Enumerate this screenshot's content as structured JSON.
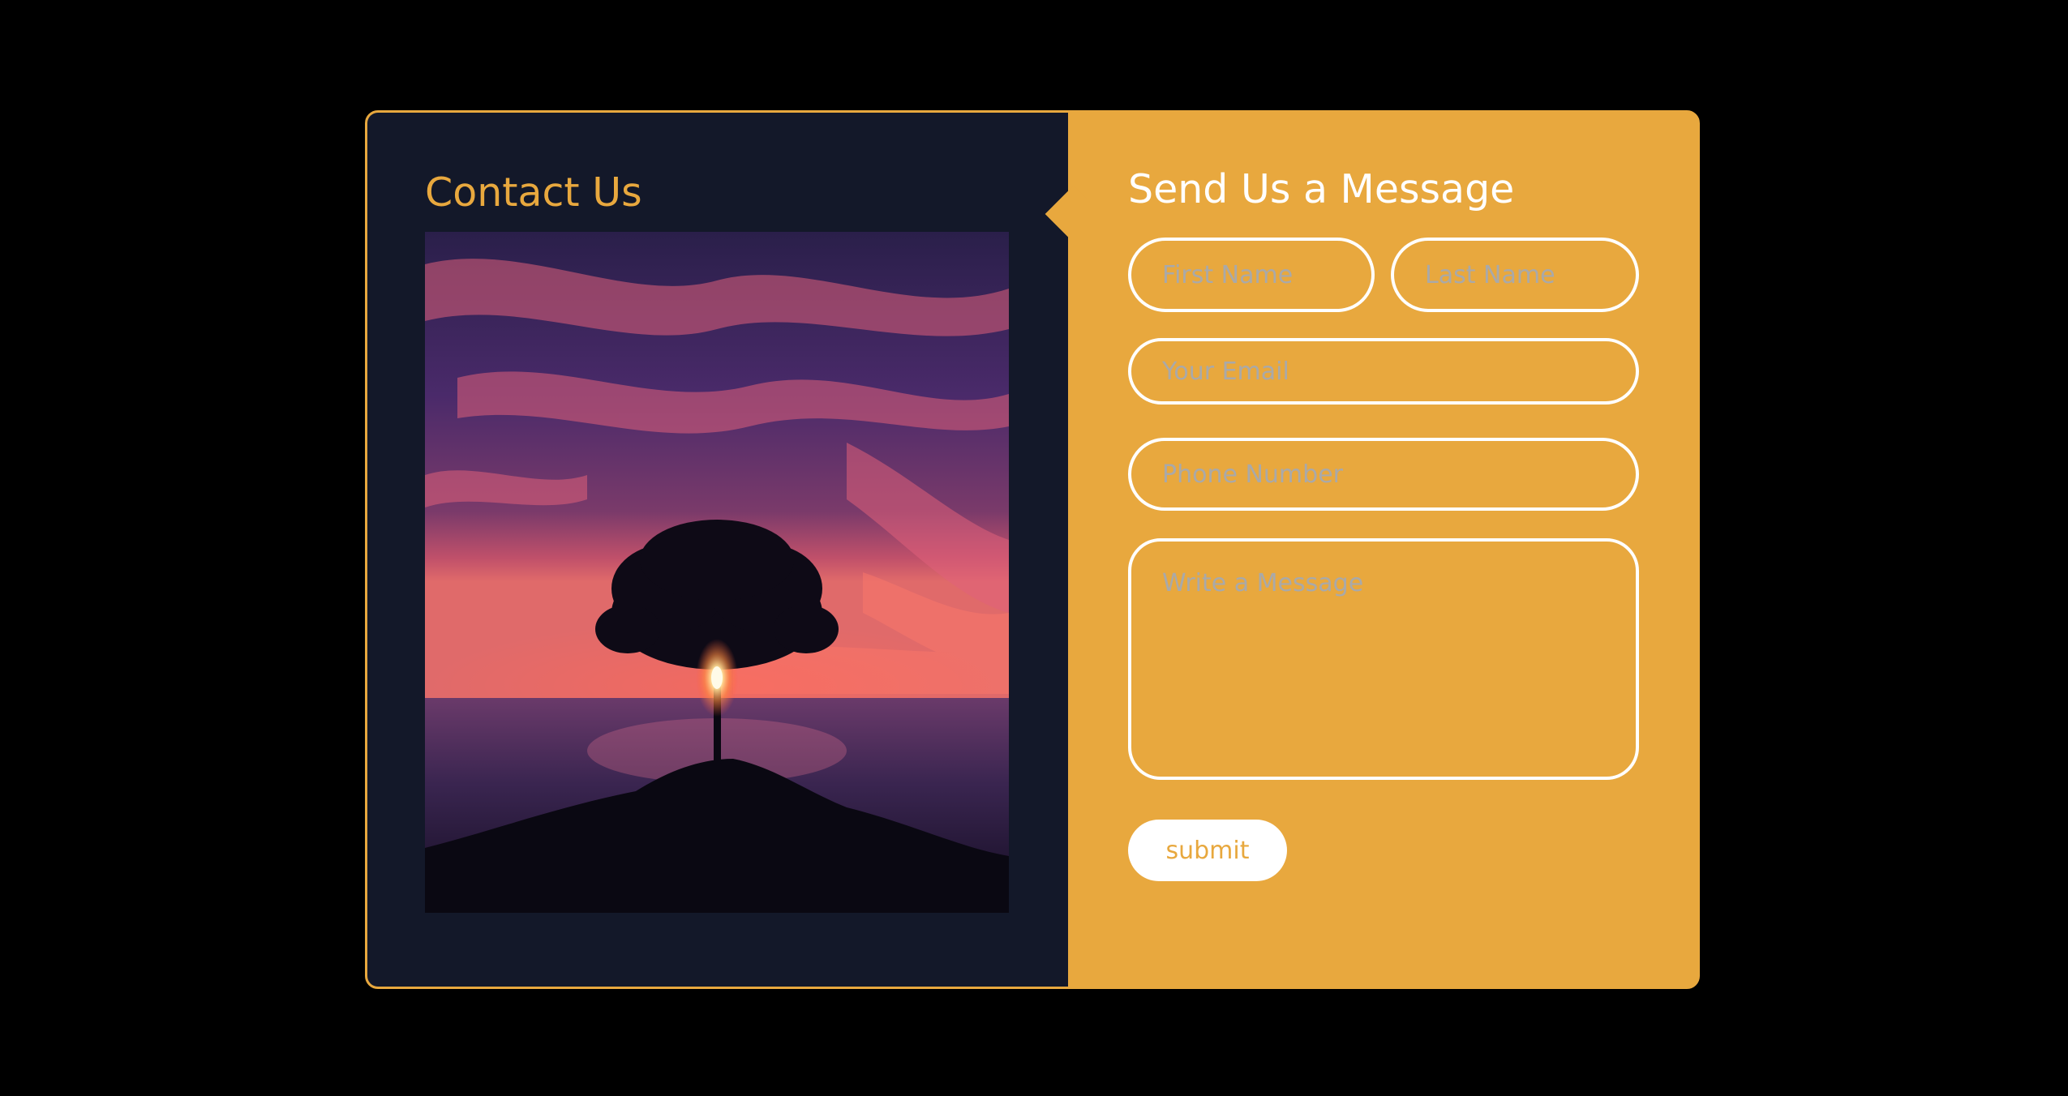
{
  "left": {
    "title": "Contact Us"
  },
  "form": {
    "title": "Send Us a Message",
    "first_name_placeholder": "First Name",
    "last_name_placeholder": "Last Name",
    "email_placeholder": "Your Email",
    "phone_placeholder": "Phone Number",
    "message_placeholder": "Write a Message",
    "submit_label": "submit"
  },
  "colors": {
    "accent": "#e8a83e",
    "panel": "#131829",
    "background": "#000000"
  }
}
